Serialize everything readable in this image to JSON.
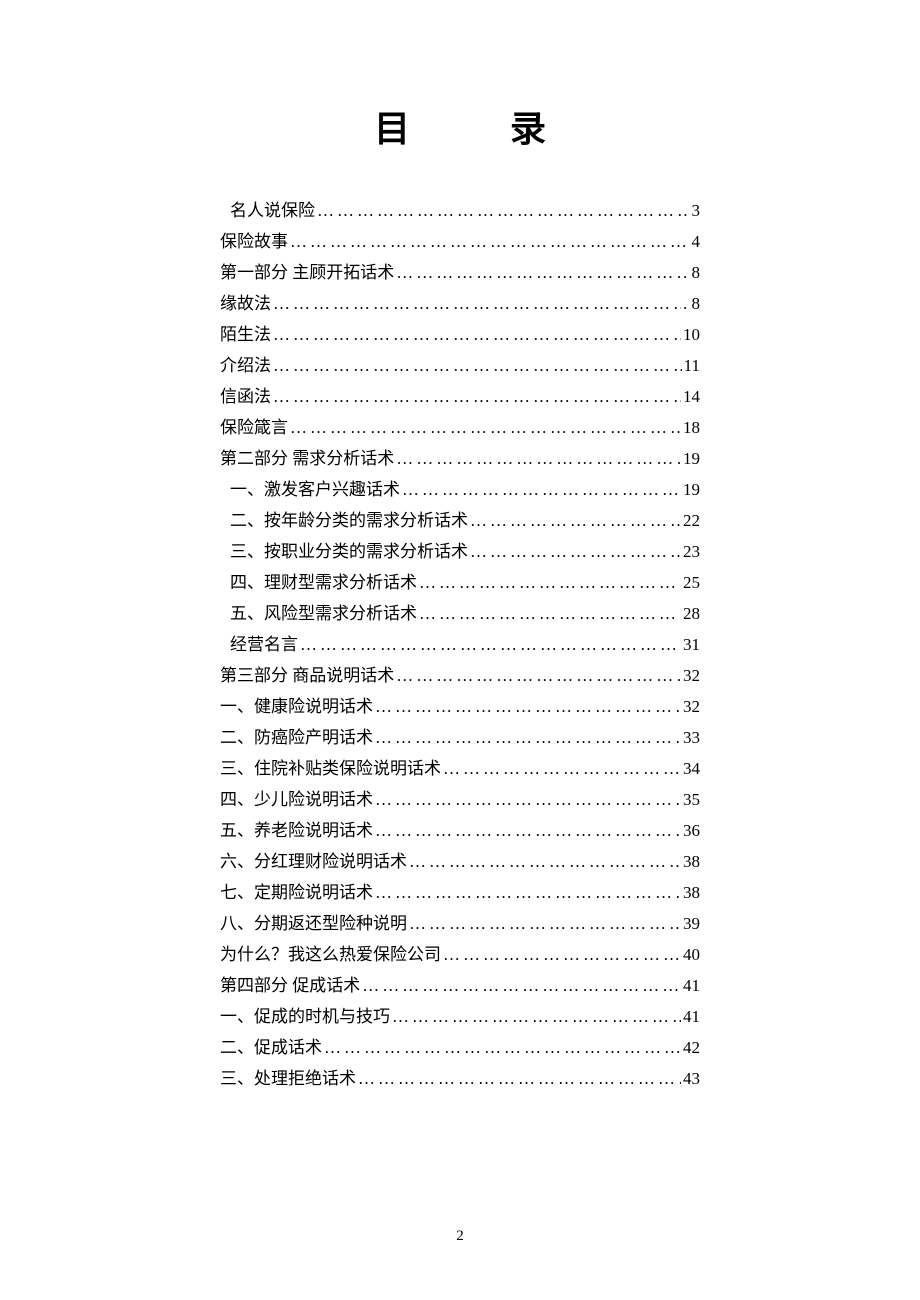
{
  "title": "目录",
  "page_number": "2",
  "entries": [
    {
      "label": "名人说保险",
      "page": "3",
      "indent": 1
    },
    {
      "label": "保险故事",
      "page": "4",
      "indent": 0
    },
    {
      "label": "第一部分  主顾开拓话术",
      "page": ". 8",
      "indent": 0
    },
    {
      "label": "缘故法",
      "page": ". 8",
      "indent": 0
    },
    {
      "label": "陌生法",
      "page": "10",
      "indent": 0
    },
    {
      "label": "介绍法",
      "page": "11",
      "indent": 0
    },
    {
      "label": "信函法",
      "page": "14",
      "indent": 0
    },
    {
      "label": "保险箴言",
      "page": "18",
      "indent": 0
    },
    {
      "label": "第二部分  需求分析话术",
      "page": "19",
      "indent": 0
    },
    {
      "label": "一、激发客户兴趣话术",
      "page": "19",
      "indent": 1
    },
    {
      "label": "二、按年龄分类的需求分析话术",
      "page": "22",
      "indent": 1
    },
    {
      "label": "三、按职业分类的需求分析话术",
      "page": "23",
      "indent": 1
    },
    {
      "label": "四、理财型需求分析话术",
      "page": "25",
      "indent": 1
    },
    {
      "label": "五、风险型需求分析话术",
      "page": "28",
      "indent": 1
    },
    {
      "label": "经营名言",
      "page": "31",
      "indent": 1
    },
    {
      "label": "第三部分  商品说明话术",
      "page": "32",
      "indent": 0
    },
    {
      "label": "一、健康险说明话术 ",
      "page": "32",
      "indent": 0
    },
    {
      "label": "二、防癌险产明话术 ",
      "page": "33",
      "indent": 0
    },
    {
      "label": "三、住院补贴类保险说明话术 ",
      "page": "34",
      "indent": 0
    },
    {
      "label": "四、少儿险说明话术 ",
      "page": "35",
      "indent": 0
    },
    {
      "label": "五、养老险说明话术 ",
      "page": "36",
      "indent": 0
    },
    {
      "label": "六、分红理财险说明话术 ",
      "page": "38",
      "indent": 0
    },
    {
      "label": "七、定期险说明话术 ",
      "page": "38",
      "indent": 0
    },
    {
      "label": "八、分期返还型险种说明 ",
      "page": "39",
      "indent": 0
    },
    {
      "label": "为什么？我这么热爱保险公司 ",
      "page": "40",
      "indent": 0
    },
    {
      "label": "第四部分  促成话术 ",
      "page": "41",
      "indent": 0
    },
    {
      "label": "一、促成的时机与技巧 ",
      "page": "41",
      "indent": 0
    },
    {
      "label": "二、促成话术 ",
      "page": "42",
      "indent": 0
    },
    {
      "label": "三、处理拒绝话术 ",
      "page": "43",
      "indent": 0
    }
  ]
}
